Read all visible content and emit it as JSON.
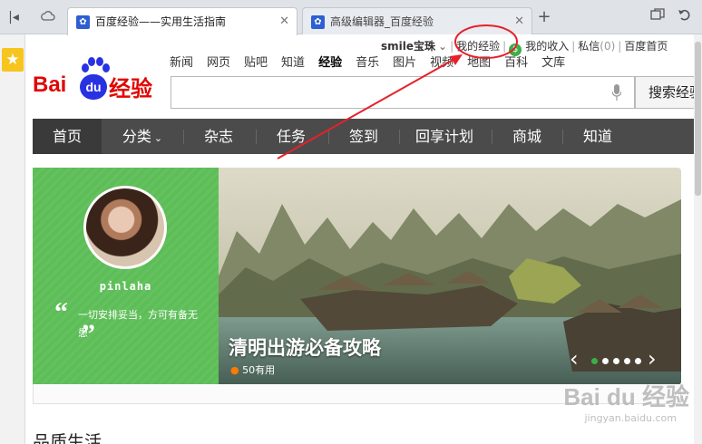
{
  "tabs": [
    {
      "label": "百度经验——实用生活指南",
      "favicon": "baidu-paw-icon",
      "active": true
    },
    {
      "label": "高级编辑器_百度经验",
      "favicon": "baidu-paw-icon",
      "active": false
    }
  ],
  "toolbar": {
    "back_icon": "back-icon",
    "cloud_icon": "cloud-icon",
    "new_tab": "+",
    "restore_icon": "restore-icon",
    "undo_icon": "undo-icon"
  },
  "user": {
    "name": "smile宝珠",
    "my_experience": "我的经验",
    "my_income": "我的收入",
    "messages": "私信",
    "messages_count": "(0)",
    "home": "百度首页"
  },
  "logo": {
    "bai": "Bai",
    "du": "du",
    "jingyan": "经验"
  },
  "topnav": [
    "新闻",
    "网页",
    "贴吧",
    "知道",
    "经验",
    "音乐",
    "图片",
    "视频",
    "地图",
    "百科",
    "文库"
  ],
  "topnav_current": "经验",
  "search": {
    "value": "",
    "button": "搜索经验"
  },
  "mainnav": [
    "首页",
    "分类",
    "杂志",
    "任务",
    "签到",
    "回享计划",
    "商城",
    "知道"
  ],
  "profile": {
    "username": "pinlaha",
    "motto": "一切安排妥当，方可有备无患"
  },
  "hero": {
    "caption": "清明出游必备攻略",
    "likes": "50有用"
  },
  "section_title": "品质生活",
  "colors": {
    "brand_red": "#e10601",
    "brand_blue": "#2932e1",
    "nav_bg": "#4b4b4b",
    "profile_green": "#5dbe57",
    "annotation_red": "#e8202a"
  },
  "watermark": {
    "text": "Bai du 经验",
    "url": "jingyan.baidu.com"
  }
}
